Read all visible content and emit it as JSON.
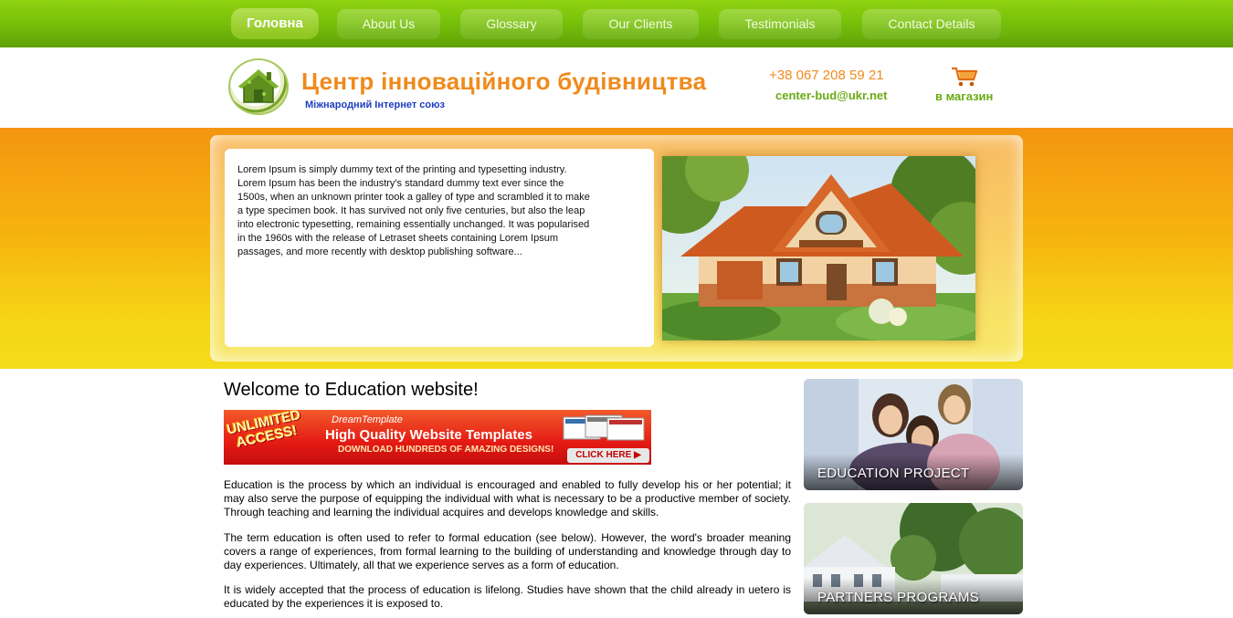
{
  "nav": {
    "items": [
      {
        "label": "Головна"
      },
      {
        "label": "About Us"
      },
      {
        "label": "Glossary"
      },
      {
        "label": "Our Clients"
      },
      {
        "label": "Testimonials"
      },
      {
        "label": "Contact Details"
      }
    ]
  },
  "header": {
    "title": "Центр інноваційного будівництва",
    "subtitle": "Міжнародний Інтернет союз",
    "phone": "+38 067 208 59 21",
    "email": "center-bud@ukr.net",
    "shop_label": "в магазин",
    "cart_icon": "shopping-cart-icon"
  },
  "banner": {
    "text": "Lorem Ipsum is simply dummy text of the printing and typesetting industry. Lorem Ipsum has been the industry's standard dummy text ever since the 1500s, when an unknown printer took a galley of type and scrambled it to make a type specimen book. It has survived not only five centuries, but also the leap into electronic typesetting, remaining essentially unchanged. It was popularised in the 1960s with the release of Letraset sheets containing Lorem Ipsum passages, and more recently with desktop publishing software..."
  },
  "main": {
    "welcome": "Welcome to Education website!",
    "ad": {
      "badge": "UNLIMITED ACCESS!",
      "brand": "DreamTemplate",
      "headline": "High Quality Website Templates",
      "sub": "DOWNLOAD HUNDREDS OF AMAZING DESIGNS!",
      "cta": "CLICK HERE"
    },
    "paragraphs": [
      "Education is the process by which an individual is encouraged and enabled to fully develop his or her potential; it may also serve the purpose of equipping the individual with what is necessary to be a productive member of society. Through teaching and learning the individual acquires and develops knowledge and skills.",
      "The term education is often used to refer to formal education (see below). However, the word's broader meaning covers a range of experiences, from formal learning to the building of understanding and knowledge through day to day experiences. Ultimately, all that we experience serves as a form of education.",
      "It is widely accepted that the process of education is lifelong. Studies have shown that the child already in uetero is educated by the experiences it is exposed to."
    ]
  },
  "sidebar": {
    "cards": [
      {
        "label": "EDUCATION PROJECT"
      },
      {
        "label": "PARTNERS PROGRAMS"
      }
    ]
  },
  "colors": {
    "nav_green": "#79c20a",
    "accent_orange": "#f08a1c",
    "accent_green": "#6aaa13",
    "subtitle_blue": "#1d3fbf"
  }
}
